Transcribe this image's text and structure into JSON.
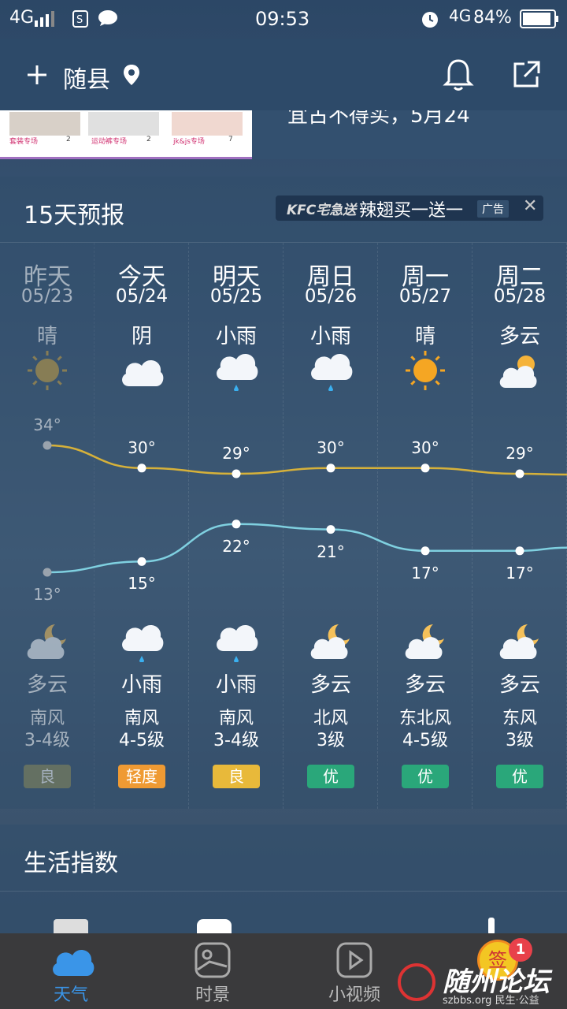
{
  "status_bar": {
    "network": "4G",
    "time": "09:53",
    "battery": "84%",
    "network2": "4G"
  },
  "header": {
    "city": "随县"
  },
  "top_ad": {
    "text": "宜古不得买，5月24",
    "thumbs": [
      "套装专场",
      "运动裤专场",
      "jk&js专场"
    ],
    "thumb_counts": [
      "2",
      "2",
      "7"
    ]
  },
  "forecast": {
    "title": "15天预报",
    "ad": {
      "brand": "KFC宅急送",
      "text": "辣翅买一送一",
      "tag": "广告"
    },
    "days": [
      {
        "day": "昨天",
        "date": "05/23",
        "cond_day": "晴",
        "icon_day": "sun-icon",
        "high": "34°",
        "low": "13°",
        "cond_night": "多云",
        "icon_night": "cloud-moon-icon",
        "wind_dir": "南风",
        "wind_level": "3-4级",
        "aqi": "良",
        "aqi_color": "#8a8a5a"
      },
      {
        "day": "今天",
        "date": "05/24",
        "cond_day": "阴",
        "icon_day": "cloud-icon",
        "high": "30°",
        "low": "15°",
        "cond_night": "小雨",
        "icon_night": "rain-icon",
        "wind_dir": "南风",
        "wind_level": "4-5级",
        "aqi": "轻度",
        "aqi_color": "#ef9a33"
      },
      {
        "day": "明天",
        "date": "05/25",
        "cond_day": "小雨",
        "icon_day": "rain-icon",
        "high": "29°",
        "low": "22°",
        "cond_night": "小雨",
        "icon_night": "rain-icon",
        "wind_dir": "南风",
        "wind_level": "3-4级",
        "aqi": "良",
        "aqi_color": "#e8b93a"
      },
      {
        "day": "周日",
        "date": "05/26",
        "cond_day": "小雨",
        "icon_day": "rain-icon",
        "high": "30°",
        "low": "21°",
        "cond_night": "多云",
        "icon_night": "cloud-moon-icon",
        "wind_dir": "北风",
        "wind_level": "3级",
        "aqi": "优",
        "aqi_color": "#2aa77a"
      },
      {
        "day": "周一",
        "date": "05/27",
        "cond_day": "晴",
        "icon_day": "sun-icon",
        "high": "30°",
        "low": "17°",
        "cond_night": "多云",
        "icon_night": "cloud-moon-icon",
        "wind_dir": "东北风",
        "wind_level": "4-5级",
        "aqi": "优",
        "aqi_color": "#2aa77a"
      },
      {
        "day": "周二",
        "date": "05/28",
        "cond_day": "多云",
        "icon_day": "cloud-sun-icon",
        "high": "29°",
        "low": "17°",
        "cond_night": "多云",
        "icon_night": "cloud-moon-icon",
        "wind_dir": "东风",
        "wind_level": "3级",
        "aqi": "优",
        "aqi_color": "#2aa77a"
      }
    ]
  },
  "chart_data": {
    "type": "line",
    "categories": [
      "05/23",
      "05/24",
      "05/25",
      "05/26",
      "05/27",
      "05/28"
    ],
    "series": [
      {
        "values": [
          34,
          30,
          29,
          30,
          30,
          29
        ]
      },
      {
        "values": [
          13,
          15,
          22,
          21,
          17,
          17
        ]
      }
    ]
  },
  "life_index": {
    "title": "生活指数"
  },
  "bottom_nav": {
    "items": [
      "天气",
      "时景",
      "小视频"
    ],
    "badge": "1",
    "sign_label": "签",
    "watermark_name": "随州论坛",
    "watermark_sub": "szbbs.org 民生·公益"
  },
  "colors": {
    "high_line": "#d6b13a",
    "low_line": "#7fd0e0",
    "nav_active": "#3a95e8"
  }
}
